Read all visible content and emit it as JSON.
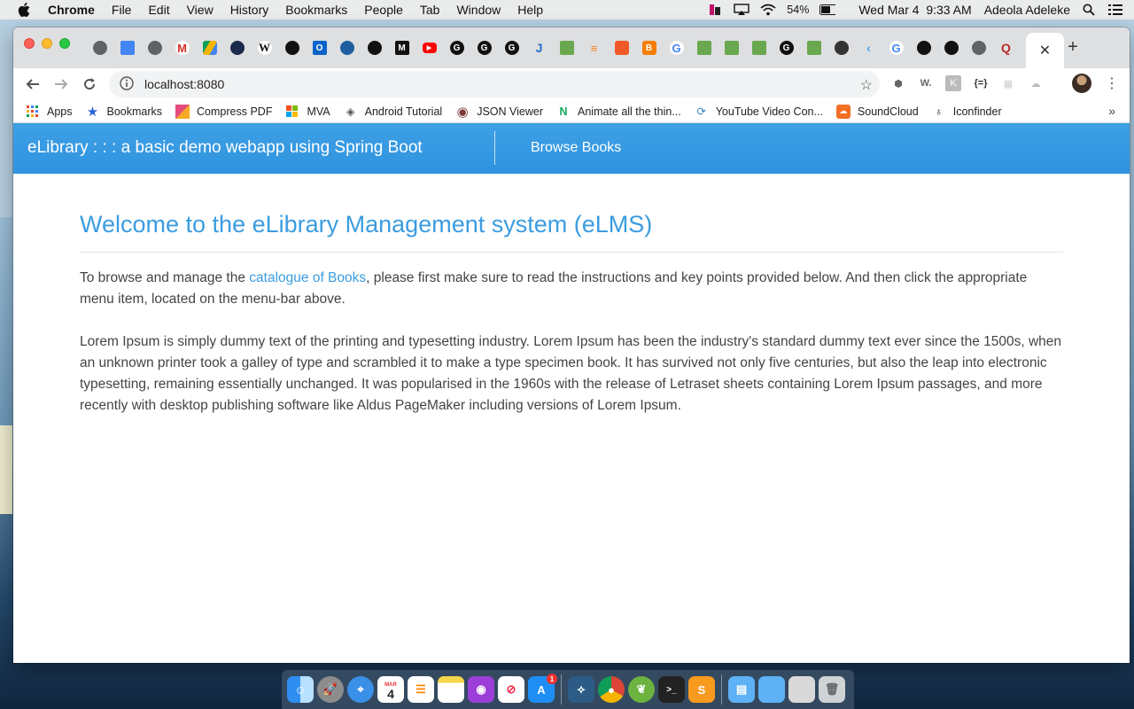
{
  "menubar": {
    "app_name": "Chrome",
    "items": [
      "File",
      "Edit",
      "View",
      "History",
      "Bookmarks",
      "People",
      "Tab",
      "Window",
      "Help"
    ],
    "battery": "54%",
    "datetime": "Wed Mar 4  9:33 AM",
    "user": "Adeola Adeleke"
  },
  "browser": {
    "url": "localhost:8080",
    "active_tab_close": "✕",
    "new_tab": "+",
    "bookmarks": [
      {
        "label": "Apps",
        "icon": "apps-grid-icon",
        "color": "#e0463a"
      },
      {
        "label": "Bookmarks",
        "icon": "star-icon",
        "color": "#2a66d8"
      },
      {
        "label": "Compress PDF",
        "icon": "compress-pdf-icon",
        "color": "#e64b7d"
      },
      {
        "label": "MVA",
        "icon": "microsoft-icon",
        "color": "#f25022"
      },
      {
        "label": "Android Tutorial",
        "icon": "diamond-icon",
        "color": "#555555"
      },
      {
        "label": "JSON Viewer",
        "icon": "json-viewer-icon",
        "color": "#7a3a3a"
      },
      {
        "label": "Animate all the thin...",
        "icon": "animate-icon",
        "color": "#14a85a"
      },
      {
        "label": "YouTube Video Con...",
        "icon": "converter-icon",
        "color": "#3a86c8"
      },
      {
        "label": "SoundCloud",
        "icon": "soundcloud-icon",
        "color": "#f26f23"
      },
      {
        "label": "Iconfinder",
        "icon": "iconfinder-icon",
        "color": "#222222"
      }
    ],
    "more": "»"
  },
  "page": {
    "brand": "eLibrary : : : a basic demo webapp using Spring Boot",
    "nav_link": "Browse Books",
    "heading": "Welcome to the eLibrary Management system (eLMS)",
    "intro_before": "To browse and manage the ",
    "intro_link": "catalogue of Books",
    "intro_after": ", please first make sure to read the instructions and key points provided below. And then click the appropriate menu item, located on the menu-bar above.",
    "lorem": "Lorem Ipsum is simply dummy text of the printing and typesetting industry. Lorem Ipsum has been the industry's standard dummy text ever since the 1500s, when an unknown printer took a galley of type and scrambled it to make a type specimen book. It has survived not only five centuries, but also the leap into electronic typesetting, remaining essentially unchanged. It was popularised in the 1960s with the release of Letraset sheets containing Lorem Ipsum passages, and more recently with desktop publishing software like Aldus PageMaker including versions of Lorem Ipsum."
  },
  "colors": {
    "navbar": "#3ea0e5",
    "heading": "#3b9ce0",
    "link": "#3b9ce0",
    "text": "#444444"
  },
  "dock": {
    "calendar_day": "4",
    "calendar_month": "MAR",
    "appstore_badge": "1"
  }
}
